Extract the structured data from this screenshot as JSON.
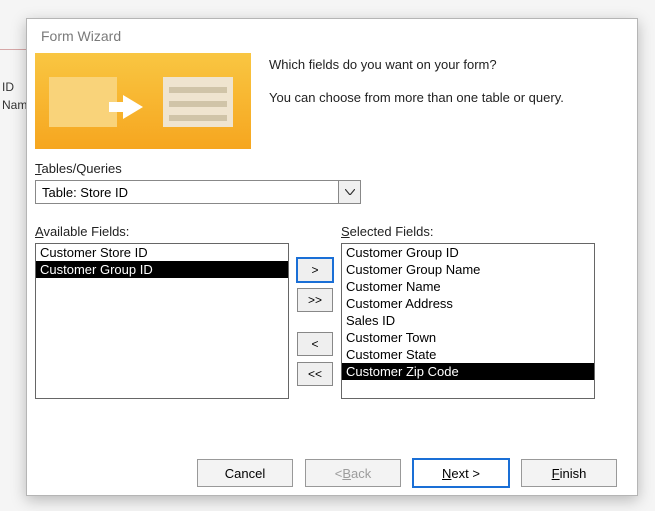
{
  "background": {
    "col1": "ID",
    "col2": "Nam"
  },
  "dialog": {
    "title": "Form Wizard",
    "intro_line1": "Which fields do you want on your form?",
    "intro_line2": "You can choose from more than one table or query.",
    "tables_label_pre": "T",
    "tables_label_rest": "ables/Queries",
    "combo_value": "Table: Store ID",
    "available_label_pre": "A",
    "available_label_rest": "vailable Fields:",
    "selected_label_pre": "S",
    "selected_label_rest": "elected Fields:",
    "available_fields": [
      {
        "label": "Customer Store ID",
        "selected": false
      },
      {
        "label": "Customer Group ID",
        "selected": true
      }
    ],
    "selected_fields": [
      {
        "label": "Customer Group ID",
        "selected": false
      },
      {
        "label": "Customer Group Name",
        "selected": false
      },
      {
        "label": "Customer Name",
        "selected": false
      },
      {
        "label": "Customer Address",
        "selected": false
      },
      {
        "label": "Sales ID",
        "selected": false
      },
      {
        "label": "Customer Town",
        "selected": false
      },
      {
        "label": "Customer State",
        "selected": false
      },
      {
        "label": "Customer Zip Code",
        "selected": true
      }
    ],
    "move": {
      "add": ">",
      "add_all": ">>",
      "remove": "<",
      "remove_all": "<<"
    },
    "buttons": {
      "cancel": "Cancel",
      "back_pre": "< ",
      "back_ul": "B",
      "back_rest": "ack",
      "next_ul": "N",
      "next_rest": "ext >",
      "finish_ul": "F",
      "finish_rest": "inish"
    }
  }
}
